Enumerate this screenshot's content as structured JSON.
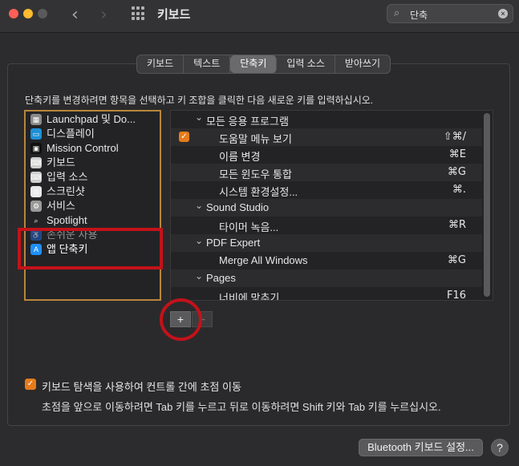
{
  "window": {
    "title": "키보드",
    "back_icon": "‹",
    "forward_icon": "›"
  },
  "search": {
    "value": "단축",
    "icon": "⌕",
    "clear": "×"
  },
  "tabs": [
    {
      "label": "키보드",
      "active": false
    },
    {
      "label": "텍스트",
      "active": false
    },
    {
      "label": "단축키",
      "active": true
    },
    {
      "label": "입력 소스",
      "active": false
    },
    {
      "label": "받아쓰기",
      "active": false
    }
  ],
  "instruction": "단축키를 변경하려면 항목을 선택하고 키 조합을 클릭한 다음 새로운 키를 입력하십시오.",
  "left_list": {
    "items": [
      {
        "label": "Launchpad 및 Do...",
        "icon": "launchpad-icon",
        "color": "#8a8a8a",
        "glyph": "▦"
      },
      {
        "label": "디스플레이",
        "icon": "display-icon",
        "color": "#1e90d6",
        "glyph": "▭"
      },
      {
        "label": "Mission Control",
        "icon": "mission-control-icon",
        "color": "#111111",
        "glyph": "▣"
      },
      {
        "label": "키보드",
        "icon": "keyboard-icon",
        "color": "#cfcfcf",
        "glyph": "⌨"
      },
      {
        "label": "입력 소스",
        "icon": "input-source-icon",
        "color": "#cfcfcf",
        "glyph": "⌨"
      },
      {
        "label": "스크린샷",
        "icon": "screenshot-icon",
        "color": "#e8e8e8",
        "glyph": "◎"
      },
      {
        "label": "서비스",
        "icon": "services-icon",
        "color": "#9a9a9a",
        "glyph": "⚙"
      },
      {
        "label": "Spotlight",
        "icon": "spotlight-icon",
        "color": "transparent",
        "glyph": "⌕"
      },
      {
        "label": "손쉬운 사용",
        "icon": "accessibility-icon",
        "color": "#1e6fd6",
        "glyph": "♿"
      },
      {
        "label": "앱 단축키",
        "icon": "app-store-icon",
        "color": "#1e90ff",
        "glyph": "A",
        "selected": true
      }
    ]
  },
  "shortcuts": {
    "rows": [
      {
        "type": "group",
        "label": "모든 응용 프로그램"
      },
      {
        "type": "item",
        "label": "도움말 메뉴 보기",
        "keys": "⇧⌘/",
        "checked": true
      },
      {
        "type": "item",
        "label": "이름 변경",
        "keys": "⌘E"
      },
      {
        "type": "item",
        "label": "모든 윈도우 통합",
        "keys": "⌘G"
      },
      {
        "type": "item",
        "label": "시스템 환경설정...",
        "keys": "⌘."
      },
      {
        "type": "group",
        "label": "Sound Studio"
      },
      {
        "type": "item",
        "label": "타이머 녹음...",
        "keys": "⌘R"
      },
      {
        "type": "group",
        "label": "PDF Expert"
      },
      {
        "type": "item",
        "label": "Merge All Windows",
        "keys": "⌘G"
      },
      {
        "type": "group",
        "label": "Pages"
      },
      {
        "type": "item",
        "label": "너비에 맞추기",
        "keys": "F16"
      }
    ]
  },
  "buttons": {
    "add": "+",
    "remove": "−"
  },
  "keyboard_nav": {
    "checked": true,
    "label": "키보드 탐색을 사용하여 컨트롤 간에 초점 이동",
    "help": "초점을 앞으로 이동하려면 Tab 키를 누르고 뒤로 이동하려면 Shift 키와 Tab 키를 누르십시오."
  },
  "footer": {
    "bluetooth_button": "Bluetooth 키보드 설정...",
    "help_button": "?"
  },
  "colors": {
    "accent": "#e57c1b",
    "selection": "#c75d00",
    "annotation_red": "#c3121a",
    "annotation_gold": "#b8863b"
  }
}
